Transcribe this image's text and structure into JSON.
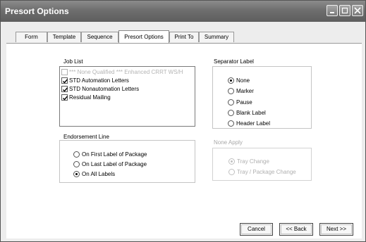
{
  "window": {
    "title": "Presort Options"
  },
  "tabs": [
    {
      "label": "Form"
    },
    {
      "label": "Template"
    },
    {
      "label": "Sequence"
    },
    {
      "label": "Presort Options"
    },
    {
      "label": "Print To"
    },
    {
      "label": "Summary"
    }
  ],
  "job_list": {
    "label": "Job List",
    "items": [
      {
        "label": "*** None Qualified *** Enhanced CRRT WS/H",
        "checked": false,
        "disabled": true
      },
      {
        "label": "STD Automation Letters",
        "checked": true,
        "disabled": false
      },
      {
        "label": "STD Nonautomation Letters",
        "checked": true,
        "disabled": false
      },
      {
        "label": "Residual Mailing",
        "checked": true,
        "disabled": false
      }
    ]
  },
  "endorsement_line": {
    "label": "Endorsement Line",
    "options": [
      {
        "label": "On First Label of Package",
        "selected": false
      },
      {
        "label": "On Last Label of Package",
        "selected": false
      },
      {
        "label": "On All Labels",
        "selected": true
      }
    ]
  },
  "separator_label": {
    "label": "Separator Label",
    "options": [
      {
        "label": "None",
        "selected": true
      },
      {
        "label": "Marker",
        "selected": false
      },
      {
        "label": "Pause",
        "selected": false
      },
      {
        "label": "Blank Label",
        "selected": false
      },
      {
        "label": "Header Label",
        "selected": false
      }
    ]
  },
  "none_apply": {
    "label": "None Apply",
    "options": [
      {
        "label": "Tray Change",
        "selected": true
      },
      {
        "label": "Tray / Package Change",
        "selected": false
      }
    ]
  },
  "buttons": {
    "cancel": "Cancel",
    "back": "<< Back",
    "next": "Next >>"
  }
}
